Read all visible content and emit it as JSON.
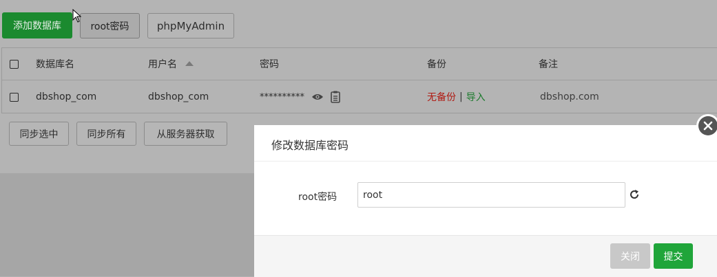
{
  "toolbar": {
    "add_db": "添加数据库",
    "root_password": "root密码",
    "phpmyadmin": "phpMyAdmin"
  },
  "table": {
    "headers": [
      "数据库名",
      "用户名",
      "密码",
      "备份",
      "备注"
    ],
    "rows": [
      {
        "db_name": "dbshop_com",
        "user": "dbshop_com",
        "password_mask": "**********",
        "backup_status": "无备份",
        "separator": "|",
        "import": "导入",
        "note": "dbshop.com"
      }
    ]
  },
  "actions": {
    "sync_selected": "同步选中",
    "sync_all": "同步所有",
    "fetch_server": "从服务器获取"
  },
  "modal": {
    "title": "修改数据库密码",
    "field_label": "root密码",
    "field_value": "root",
    "close_label": "关闭",
    "submit_label": "提交"
  },
  "colors": {
    "green": "#1b8a2f",
    "submit": "#20a53a",
    "red": "#b01a12",
    "close_disabled": "#c8c8c8"
  },
  "icons": {
    "sort": "sort-ascending-icon",
    "eye": "eye-icon",
    "copy": "clipboard-icon",
    "refresh": "refresh-icon",
    "close": "close-icon",
    "cursor": "mouse-cursor-icon"
  }
}
